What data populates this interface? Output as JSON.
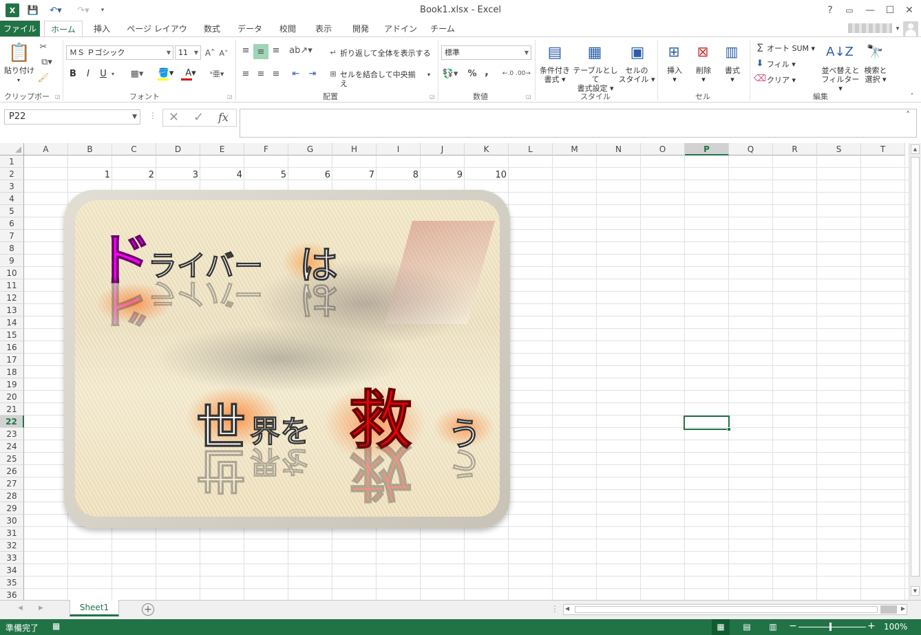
{
  "titlebar": {
    "title": "Book1.xlsx - Excel",
    "help": "?",
    "restore_ribbon": "▭",
    "minimize": "—",
    "maximize": "☐",
    "close": "✕"
  },
  "tabs": [
    "ファイル",
    "ホーム",
    "挿入",
    "ページ レイアウト",
    "数式",
    "データ",
    "校閲",
    "表示",
    "開発",
    "アドイン",
    "チーム"
  ],
  "ribbon": {
    "clipboard": {
      "paste": "貼り付け",
      "label": "クリップボード"
    },
    "font": {
      "name": "ＭＳ Ｐゴシック",
      "size": "11",
      "label": "フォント",
      "bold": "B",
      "italic": "I",
      "underline": "U"
    },
    "alignment": {
      "wrap": "折り返して全体を表示する",
      "merge": "セルを結合して中央揃え",
      "label": "配置"
    },
    "number": {
      "format": "標準",
      "label": "数値",
      "percent": "%",
      "comma": ","
    },
    "styles": {
      "conditional": [
        "条件付き",
        "書式"
      ],
      "table": [
        "テーブルとして",
        "書式設定"
      ],
      "cell": [
        "セルの",
        "スタイル"
      ],
      "label": "スタイル"
    },
    "cells": {
      "insert": "挿入",
      "delete": "削除",
      "format": "書式",
      "label": "セル"
    },
    "editing": {
      "autosum": "オート SUM",
      "fill": "フィル",
      "clear": "クリア",
      "sort": [
        "並べ替えと",
        "フィルター"
      ],
      "find": [
        "検索と",
        "選択"
      ],
      "label": "編集"
    }
  },
  "formula_bar": {
    "name_box": "P22",
    "fx": "fx",
    "value": ""
  },
  "columns": [
    "A",
    "B",
    "C",
    "D",
    "E",
    "F",
    "G",
    "H",
    "I",
    "J",
    "K",
    "L",
    "M",
    "N",
    "O",
    "P",
    "Q",
    "R",
    "S",
    "T"
  ],
  "active_column": "P",
  "active_row": "22",
  "rows": [
    "1",
    "2",
    "3",
    "4",
    "5",
    "6",
    "7",
    "8",
    "9",
    "10",
    "11",
    "12",
    "13",
    "14",
    "15",
    "16",
    "17",
    "18",
    "19",
    "20",
    "21",
    "22",
    "23",
    "24",
    "25",
    "26",
    "27",
    "28",
    "29",
    "30",
    "31",
    "32",
    "33",
    "34",
    "35",
    "36"
  ],
  "row2_values": [
    "1",
    "2",
    "3",
    "4",
    "5",
    "6",
    "7",
    "8",
    "9",
    "10"
  ],
  "banner": {
    "big_do": "ド",
    "rest1": "ライバー",
    "ha": "は",
    "sekai": "世",
    "kai": "界を",
    "sukuu": "救",
    "u": "う"
  },
  "sheet_tabs": [
    "Sheet1"
  ],
  "status": {
    "ready": "準備完了",
    "zoom": "100%"
  },
  "colors": {
    "accent": "#217346",
    "do_color": "#ff00ff",
    "sukuu_color": "#ee0000"
  }
}
